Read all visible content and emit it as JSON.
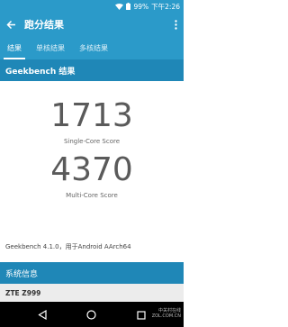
{
  "status_bar": {
    "battery": "99%",
    "time": "下午2:26"
  },
  "app_bar": {
    "title": "跑分结果"
  },
  "tabs": [
    {
      "label": "结果"
    },
    {
      "label": "单核结果"
    },
    {
      "label": "多核结果"
    }
  ],
  "section": {
    "title": "Geekbench 结果"
  },
  "scores": {
    "single": {
      "value": "1713",
      "label": "Single-Core Score"
    },
    "multi": {
      "value": "4370",
      "label": "Multi-Core Score"
    }
  },
  "version_text": "Geekbench 4.1.0，用于Android AArch64",
  "system_info": {
    "title": "系统信息",
    "device": "ZTE Z999"
  },
  "watermark": {
    "line1": "中关村在线",
    "line2": "ZOL.COM.CN"
  },
  "colors": {
    "primary": "#2b9ac9",
    "header": "#1f87b7"
  }
}
